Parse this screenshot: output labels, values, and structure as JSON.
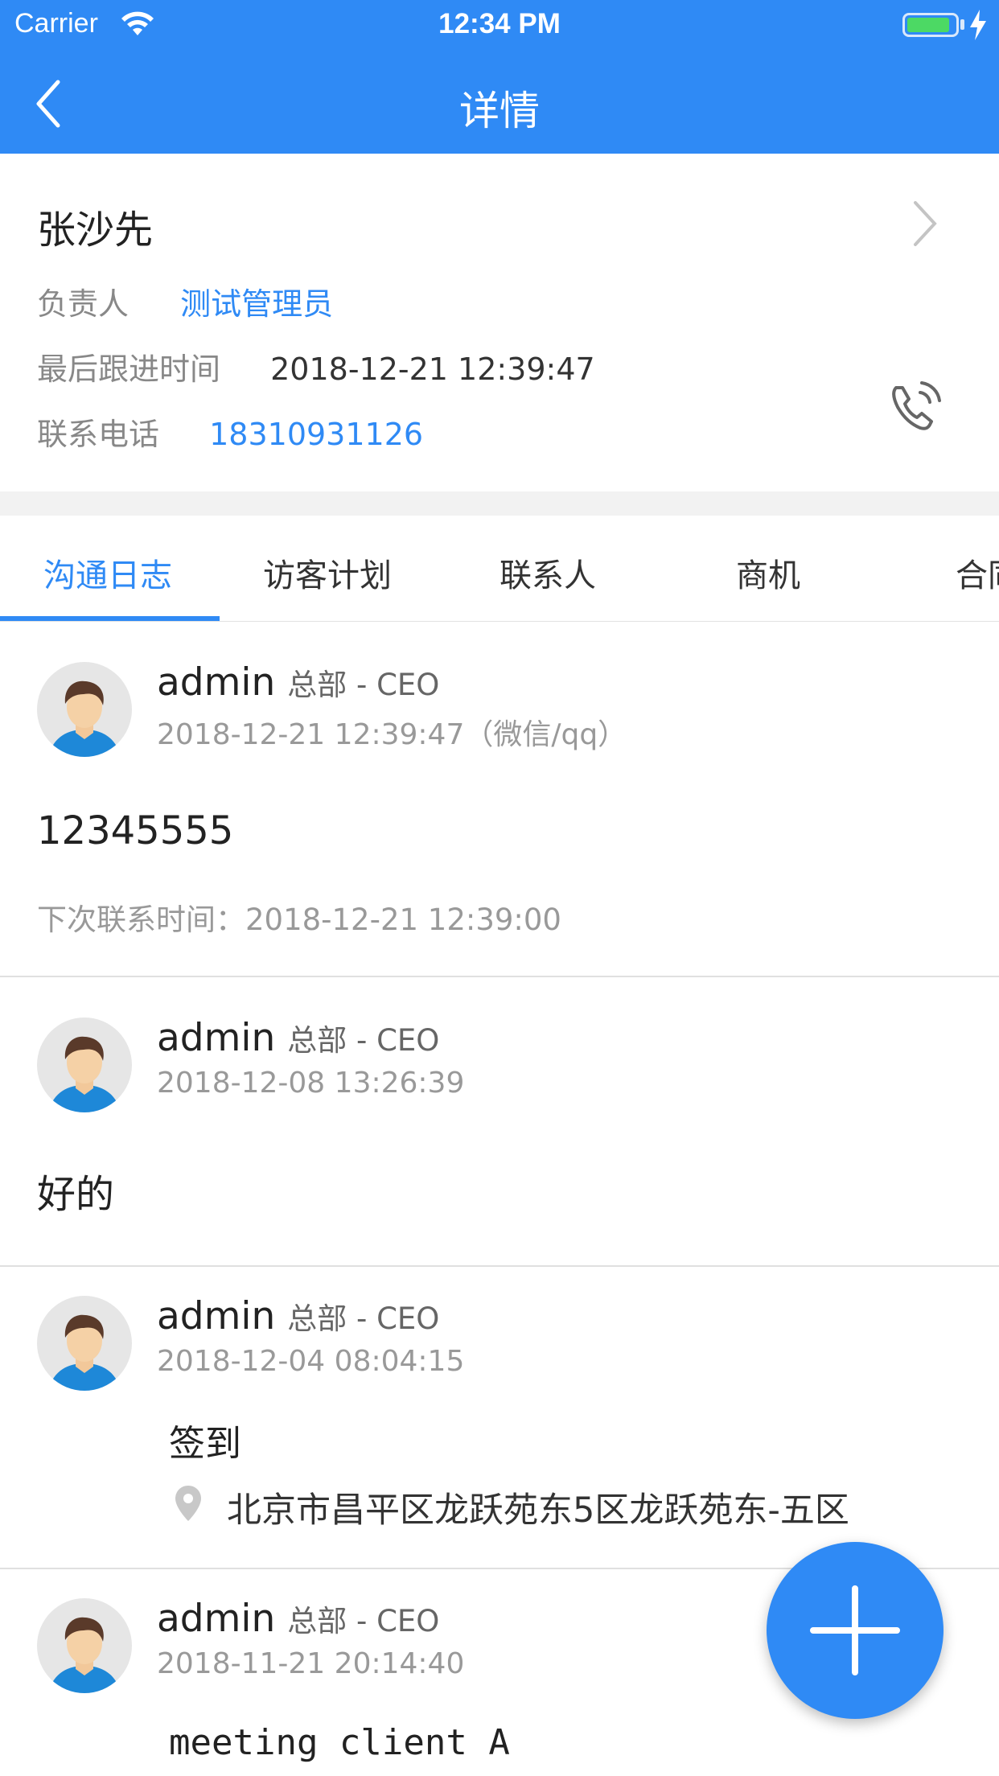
{
  "status_bar": {
    "carrier": "Carrier",
    "time": "12:34 PM",
    "battery_level": 0.9
  },
  "nav": {
    "title": "详情",
    "back_icon": "chevron-left-icon"
  },
  "customer": {
    "name": "张沙先",
    "owner_label": "负责人",
    "owner_value": "测试管理员",
    "last_follow_label": "最后跟进时间",
    "last_follow_value": "2018-12-21 12:39:47",
    "phone_label": "联系电话",
    "phone_value": "18310931126",
    "call_icon": "phone-call-icon"
  },
  "tabs": [
    "沟通日志",
    "访客计划",
    "联系人",
    "商机",
    "合同"
  ],
  "active_tab": 0,
  "logs": [
    {
      "author": "admin",
      "dept": "总部 - CEO",
      "time": "2018-12-21 12:39:47（微信/qq）",
      "content": "12345555",
      "next_contact": "下次联系时间：2018-12-21 12:39:00"
    },
    {
      "author": "admin",
      "dept": "总部 - CEO",
      "time": "2018-12-08 13:26:39",
      "content": "好的"
    },
    {
      "author": "admin",
      "dept": "总部 - CEO",
      "time": "2018-12-04 08:04:15",
      "content": "签到",
      "address": "北京市昌平区龙跃苑东5区龙跃苑东-五区"
    },
    {
      "author": "admin",
      "dept": "总部 - CEO",
      "time": "2018-11-21 20:14:40",
      "content": "meeting client A"
    }
  ],
  "colors": {
    "primary": "#2f8af5",
    "fab": "#2f8af5"
  },
  "fab_icon": "plus-icon"
}
